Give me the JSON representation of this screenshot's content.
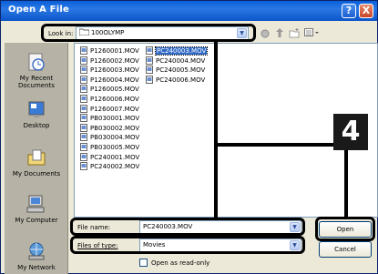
{
  "window": {
    "title": "Open A File",
    "help_label": "?",
    "close_label": "X"
  },
  "lookin": {
    "label": "Look in:",
    "value": "100OLYMP"
  },
  "places": [
    {
      "label": "My Recent\nDocuments",
      "icon": "recent-documents-icon"
    },
    {
      "label": "Desktop",
      "icon": "desktop-icon"
    },
    {
      "label": "My Documents",
      "icon": "my-documents-icon"
    },
    {
      "label": "My Computer",
      "icon": "my-computer-icon"
    },
    {
      "label": "My Network",
      "icon": "my-network-icon"
    }
  ],
  "files_col1": [
    "P1260001.MOV",
    "P1260002.MOV",
    "P1260003.MOV",
    "P1260004.MOV",
    "P1260005.MOV",
    "P1260006.MOV",
    "P1260007.MOV",
    "PB030001.MOV",
    "PB030002.MOV",
    "PB030004.MOV",
    "PB030005.MOV",
    "PC240001.MOV",
    "PC240002.MOV"
  ],
  "files_col2": [
    "PC240003.MOV",
    "PC240004.MOV",
    "PC240005.MOV",
    "PC240006.MOV"
  ],
  "selected_file": "PC240003.MOV",
  "step_number": "4",
  "filename": {
    "label": "File name:",
    "value": "PC240003.MOV"
  },
  "filetype": {
    "label": "Files of type:",
    "value": "Movies"
  },
  "readonly_label": "Open as read-only",
  "open_label": "Open",
  "cancel_label": "Cancel",
  "colors": {
    "titlebar": "#0a5fd8",
    "dialog_bg": "#ece9d8",
    "selection": "#316ac5",
    "places_bar": "#b6b3a6"
  }
}
